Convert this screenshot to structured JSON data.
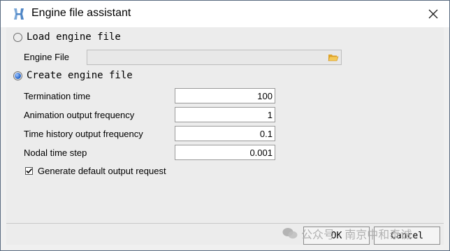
{
  "window": {
    "title": "Engine file assistant"
  },
  "load_option": {
    "label": "Load engine file",
    "selected": false
  },
  "engine_file": {
    "label": "Engine File",
    "value": ""
  },
  "create_option": {
    "label": "Create engine file",
    "selected": true
  },
  "fields": {
    "termination_time": {
      "label": "Termination time",
      "value": "100"
    },
    "animation_output_frequency": {
      "label": "Animation output frequency",
      "value": "1"
    },
    "time_history_output_frequency": {
      "label": "Time history output frequency",
      "value": "0.1"
    },
    "nodal_time_step": {
      "label": "Nodal time step",
      "value": "0.001"
    }
  },
  "generate_default": {
    "label": "Generate default output request",
    "checked": true
  },
  "buttons": {
    "ok": "OK",
    "cancel": "Cancel"
  },
  "watermark": {
    "text": "公众号 · 南京中和泰诚"
  },
  "colors": {
    "radio_accent": "#1d5fc7",
    "background": "#ececec"
  }
}
